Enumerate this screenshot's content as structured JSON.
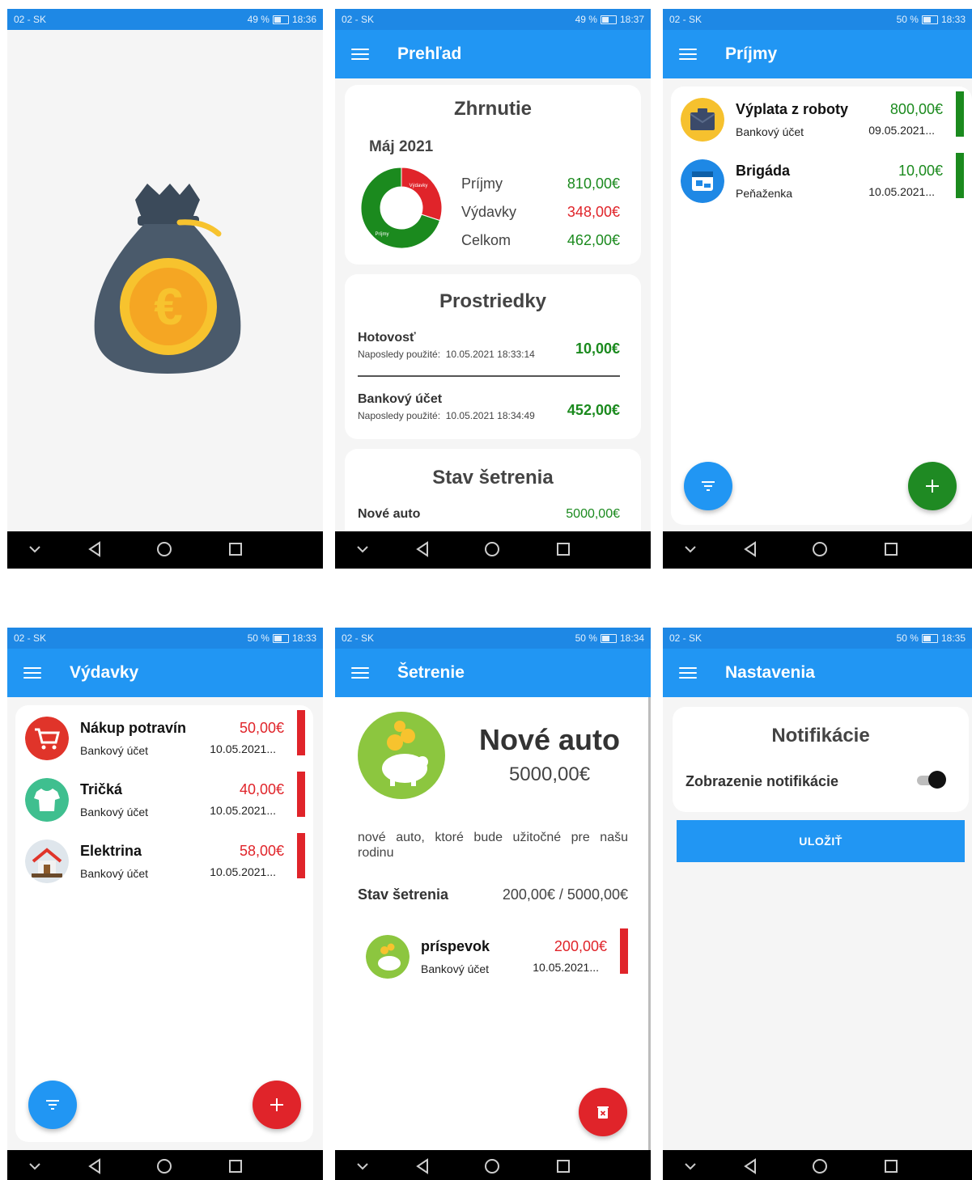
{
  "phone1": {
    "status": {
      "carrier": "02 - SK",
      "battery": "49 %",
      "time": "18:36"
    }
  },
  "phone2": {
    "status": {
      "carrier": "02 - SK",
      "battery": "49 %",
      "time": "18:37"
    },
    "title": "Prehľad",
    "summary": {
      "heading": "Zhrnutie",
      "month": "Máj 2021",
      "chart": {
        "expense_label": "Výdavky",
        "income_label": "Príjmy"
      },
      "rows": [
        {
          "label": "Príjmy",
          "value": "810,00€"
        },
        {
          "label": "Výdavky",
          "value": "348,00€"
        },
        {
          "label": "Celkom",
          "value": "462,00€"
        }
      ]
    },
    "funds": {
      "heading": "Prostriedky",
      "last_used_label": "Naposledy použité:",
      "items": [
        {
          "name": "Hotovosť",
          "date": "10.05.2021 18:33:14",
          "value": "10,00€"
        },
        {
          "name": "Bankový účet",
          "date": "10.05.2021 18:34:49",
          "value": "452,00€"
        }
      ]
    },
    "savings": {
      "heading": "Stav šetrenia",
      "items": [
        {
          "name": "Nové auto",
          "value": "5000,00€"
        }
      ]
    }
  },
  "phone3": {
    "status": {
      "carrier": "02 - SK",
      "battery": "50 %",
      "time": "18:33"
    },
    "title": "Príjmy",
    "items": [
      {
        "name": "Výplata z roboty",
        "account": "Bankový účet",
        "amount": "800,00€",
        "date": "09.05.2021..."
      },
      {
        "name": "Brigáda",
        "account": "Peňaženka",
        "amount": "10,00€",
        "date": "10.05.2021..."
      }
    ]
  },
  "phone4": {
    "status": {
      "carrier": "02 - SK",
      "battery": "50 %",
      "time": "18:33"
    },
    "title": "Výdavky",
    "items": [
      {
        "name": "Nákup potravín",
        "account": "Bankový účet",
        "amount": "50,00€",
        "date": "10.05.2021..."
      },
      {
        "name": "Tričká",
        "account": "Bankový účet",
        "amount": "40,00€",
        "date": "10.05.2021..."
      },
      {
        "name": "Elektrina",
        "account": "Bankový účet",
        "amount": "58,00€",
        "date": "10.05.2021..."
      }
    ]
  },
  "phone5": {
    "status": {
      "carrier": "02 - SK",
      "battery": "50 %",
      "time": "18:34"
    },
    "title": "Šetrenie",
    "goal": {
      "name": "Nové auto",
      "amount": "5000,00€",
      "description": "nové auto, ktoré bude užitočné pre našu rodinu",
      "progress_label": "Stav šetrenia",
      "progress_value": "200,00€ / 5000,00€"
    },
    "items": [
      {
        "name": "príspevok",
        "account": "Bankový účet",
        "amount": "200,00€",
        "date": "10.05.2021..."
      }
    ]
  },
  "phone6": {
    "status": {
      "carrier": "02 - SK",
      "battery": "50 %",
      "time": "18:35"
    },
    "title": "Nastavenia",
    "heading": "Notifikácie",
    "toggle_label": "Zobrazenie notifikácie",
    "toggle_on": true,
    "save_label": "ULOŽIŤ"
  },
  "colors": {
    "primary": "#2196f3",
    "status": "#1e88e5",
    "income": "#1b8a1e",
    "expense": "#e0242a"
  }
}
